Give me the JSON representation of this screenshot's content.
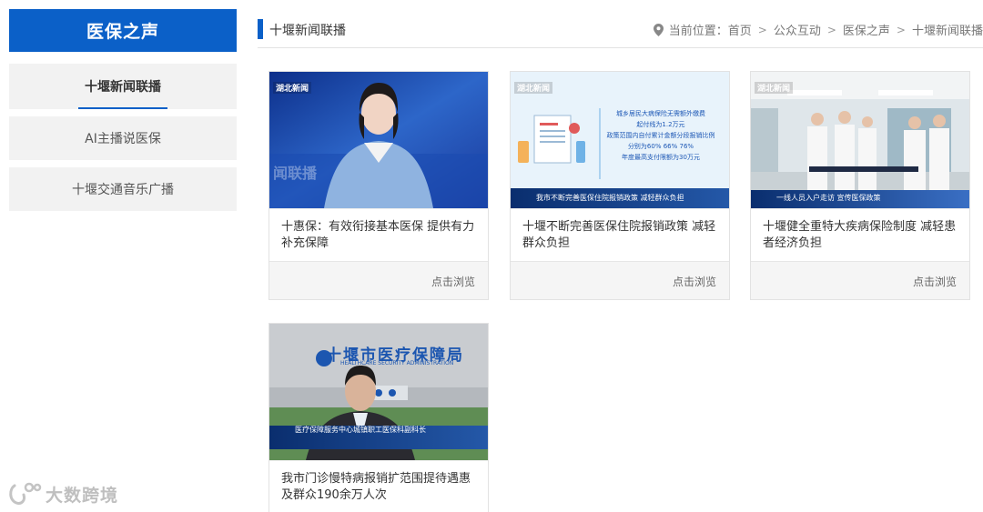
{
  "sidebar": {
    "title": "医保之声",
    "items": [
      {
        "label": "十堰新闻联播"
      },
      {
        "label": "AI主播说医保"
      },
      {
        "label": "十堰交通音乐广播"
      }
    ]
  },
  "header": {
    "title": "十堰新闻联播",
    "breadcrumb": {
      "prefix": "当前位置：",
      "items": [
        "首页",
        "公众互动",
        "医保之声",
        "十堰新闻联播"
      ],
      "separator": ">"
    }
  },
  "cards": [
    {
      "title": "十惠保：有效衔接基本医保 提供有力补充保障",
      "action": "点击浏览",
      "thumb": {
        "logo": "湖北新闻",
        "bg_text": "闻联播"
      }
    },
    {
      "title": "十堰不断完善医保住院报销政策 减轻群众负担",
      "action": "点击浏览",
      "thumb": {
        "logo": "湖北新闻",
        "lines": [
          "城乡居民大病保险无需额外缴费",
          "起付线为1.2万元",
          "政策范围内自付累计金额分段报销比例",
          "分别为60% 66% 76%",
          "年度最高支付限额为30万元"
        ],
        "caption": "我市不断完善医保住院报销政策 减轻群众负担"
      }
    },
    {
      "title": "十堰健全重特大疾病保险制度 减轻患者经济负担",
      "action": "点击浏览",
      "thumb": {
        "logo": "湖北新闻",
        "caption": "一线人员入户走访 宣传医保政策"
      }
    },
    {
      "title": "我市门诊慢特病报销扩范围提待遇惠及群众190余万人次",
      "action": "点击浏览",
      "thumb": {
        "sign": "十堰市医疗保障局",
        "sign_en": "HEALTHCARE SECURITY ADMINISTRATION",
        "caption": "医疗保障服务中心城镇职工医保科副科长"
      }
    }
  ],
  "watermark": {
    "text": "大数跨境"
  },
  "colors": {
    "brand": "#0b60c8",
    "card_bg": "#f5f5f5",
    "sidebar_bg": "#f2f2f2"
  }
}
